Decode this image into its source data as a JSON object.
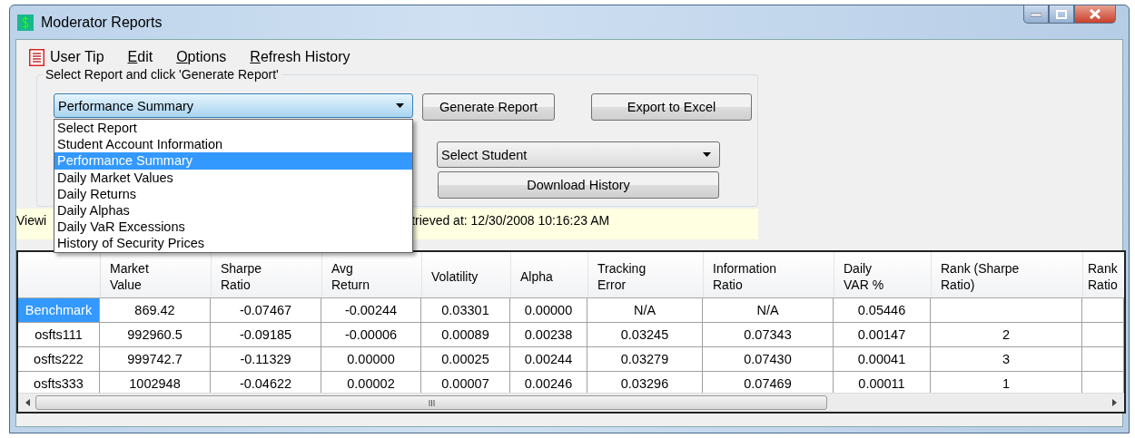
{
  "window": {
    "title": "Moderator Reports"
  },
  "menu": [
    {
      "label": "User Tip",
      "mnemonic": false,
      "kind": "icon"
    },
    {
      "label": "Edit",
      "mnemonic": true,
      "kind": "plain"
    },
    {
      "label": "Options",
      "mnemonic": true,
      "kind": "plain"
    },
    {
      "label": "Refresh History",
      "mnemonic": true,
      "kind": "plain"
    }
  ],
  "report_group": {
    "legend": "Select Report and click 'Generate Report'",
    "report_select": {
      "value": "Performance Summary",
      "expanded": true,
      "options": [
        {
          "label": "Select Report",
          "selected": false
        },
        {
          "label": "Student Account Information",
          "selected": false
        },
        {
          "label": "Performance Summary",
          "selected": true
        },
        {
          "label": "Daily Market Values",
          "selected": false
        },
        {
          "label": "Daily Returns",
          "selected": false
        },
        {
          "label": "Daily Alphas",
          "selected": false
        },
        {
          "label": "Daily VaR Excessions",
          "selected": false
        },
        {
          "label": "History of Security Prices",
          "selected": false
        }
      ]
    },
    "buttons": [
      "Generate Report",
      "Export to Excel"
    ],
    "student_select": {
      "value": "Select Student"
    },
    "download_button": "Download History"
  },
  "status": {
    "left_fragment": "Viewi",
    "right_fragment": "trieved at: 12/30/2008 10:16:23 AM"
  },
  "table": {
    "columns": [
      "Market\nValue",
      "Sharpe\nRatio",
      "Avg\nReturn",
      "Volatility",
      "Alpha",
      "Tracking\nError",
      "Information\nRatio",
      "Daily\nVAR %",
      "Rank (Sharpe\nRatio)",
      "Rank\nRatio"
    ],
    "rows": [
      {
        "header": "Benchmark",
        "selected": true,
        "cells": [
          "869.42",
          "-0.07467",
          "-0.00244",
          "0.03301",
          "0.00000",
          "N/A",
          "N/A",
          "0.05446",
          "",
          ""
        ]
      },
      {
        "header": "osfts111",
        "selected": false,
        "cells": [
          "992960.5",
          "-0.09185",
          "-0.00006",
          "0.00089",
          "0.00238",
          "0.03245",
          "0.07343",
          "0.00147",
          "2",
          ""
        ]
      },
      {
        "header": "osfts222",
        "selected": false,
        "cells": [
          "999742.7",
          "-0.11329",
          "0.00000",
          "0.00025",
          "0.00244",
          "0.03279",
          "0.07430",
          "0.00041",
          "3",
          ""
        ]
      },
      {
        "header": "osfts333",
        "selected": false,
        "cells": [
          "1002948",
          "-0.04622",
          "0.00002",
          "0.00007",
          "0.00246",
          "0.03296",
          "0.07469",
          "0.00011",
          "1",
          ""
        ]
      }
    ]
  }
}
